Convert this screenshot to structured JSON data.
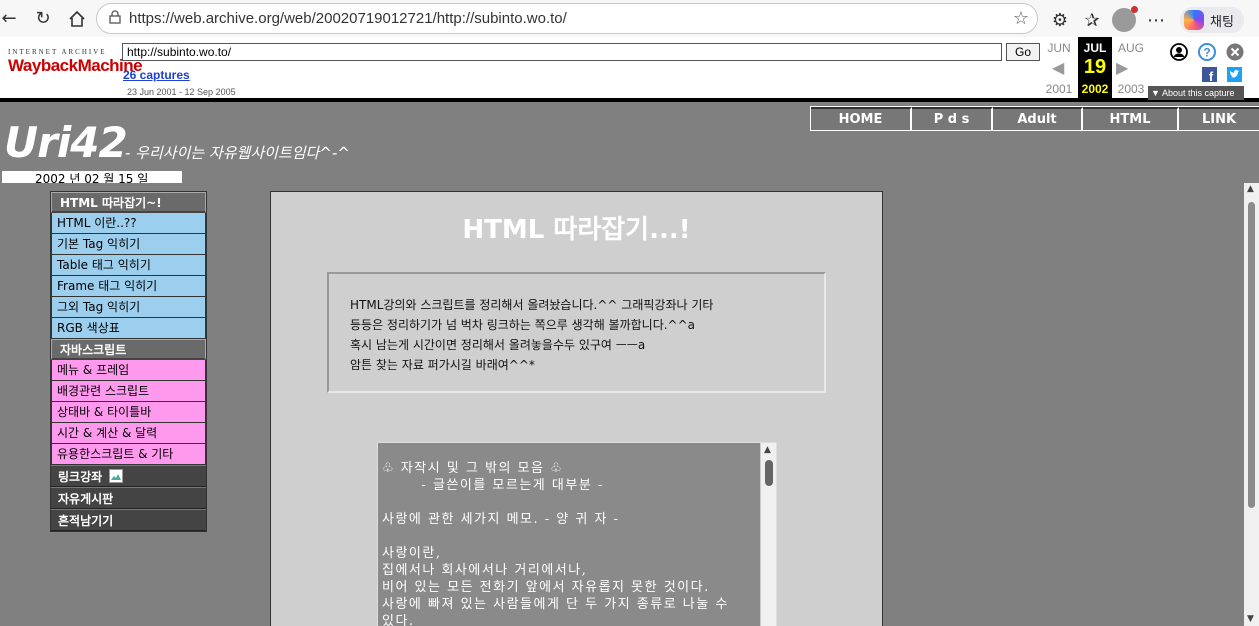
{
  "browser": {
    "url": "https://web.archive.org/web/20020719012721/http://subinto.wo.to/",
    "copilot_label": "채팅"
  },
  "wayback": {
    "logo_top": "INTERNET ARCHIVE",
    "logo_main": "WaybackMachine",
    "url_value": "http://subinto.wo.to/",
    "go_label": "Go",
    "captures": "26 captures",
    "range": "23 Jun 2001 - 12 Sep 2005",
    "prev": {
      "month": "JUN",
      "year": "2001"
    },
    "current": {
      "month": "JUL",
      "day": "19",
      "year": "2002"
    },
    "next": {
      "month": "AUG",
      "year": "2003"
    },
    "about": "About this capture"
  },
  "site": {
    "title": "Uri42",
    "subtitle": "- 우리사이는 자유웹사이트임다^-^",
    "date": "2002 년 02 월 15 일",
    "nav": [
      "HOME",
      "P d s",
      "Adult",
      "HTML",
      "LINK"
    ]
  },
  "menu": {
    "html_header": "HTML 따라잡기~!",
    "html_items": [
      "HTML 이란..??",
      "기본 Tag 익히기",
      "Table 태그 익히기",
      "Frame 태그 익히기",
      "그외 Tag 익히기",
      "RGB 색상표"
    ],
    "js_header": "자바스크립트",
    "js_items": [
      "메뉴 & 프레임",
      "배경관련 스크립트",
      "상태바 & 타이틀바",
      "시간 & 계산 & 달력",
      "유용한스크립트 & 기타"
    ],
    "link": "링크강좌",
    "board": "자유게시판",
    "guestbook": "흔적남기기"
  },
  "content": {
    "heading": "HTML 따라잡기...!",
    "intro": [
      "HTML강의와 스크립트를 정리해서 올려놨습니다.^^ 그래픽강좌나 기타",
      "등등은 정리하기가 넘 벅차 링크하는 쪽으루 생각해 볼까합니다.^^a",
      "혹시 남는게 시간이면 정리해서 올려놓을수두 있구여 ㅡㅡa",
      "암튼 찾는 자료 퍼가시길 바래여^^*"
    ],
    "poem": "♧ 자작시 및 그 밖의 모음 ♧\n       - 글쓴이를 모르는게 대부분 -\n\n사랑에 관한 세가지 메모. - 양 귀 자 -\n\n사랑이란,\n집에서나 회사에서나 거리에서나,\n비어 있는 모든 전화기 앞에서 자유롭지 못한 것이다.\n사랑에 빠져 있는 사람들에게 단 두 가지 종류로 나눌 수\n있다."
  }
}
